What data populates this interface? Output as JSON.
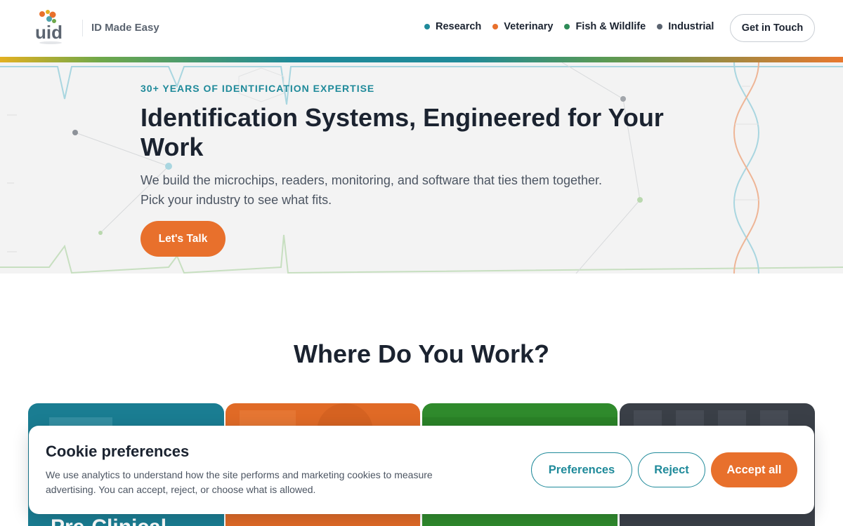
{
  "header": {
    "logo_text": "uid",
    "tagline": "ID Made Easy",
    "nav": [
      {
        "label": "Research",
        "dot_color": "#1f8a9a"
      },
      {
        "label": "Veterinary",
        "dot_color": "#e8702c"
      },
      {
        "label": "Fish & Wildlife",
        "dot_color": "#2e8b57"
      },
      {
        "label": "Industrial",
        "dot_color": "#5b6470"
      }
    ],
    "cta_label": "Get in Touch"
  },
  "hero": {
    "eyebrow": "30+ YEARS OF IDENTIFICATION EXPERTISE",
    "title": "Identification Systems, Engineered for Your Work",
    "description": "We build the microchips, readers, monitoring, and software that ties them together. Pick your industry to see what fits.",
    "button_label": "Let's Talk"
  },
  "section": {
    "title": "Where Do You Work?",
    "cards": [
      {
        "label": "Pre-Clinical",
        "color": "#1a7d92"
      },
      {
        "label": "",
        "color": "#e06a26"
      },
      {
        "label": "",
        "color": "#2f8a2c"
      },
      {
        "label": "",
        "color": "#3a3f47"
      }
    ]
  },
  "cookie": {
    "title": "Cookie preferences",
    "text": "We use analytics to understand how the site performs and marketing cookies to measure advertising. You can accept, reject, or choose what is allowed.",
    "preferences_label": "Preferences",
    "reject_label": "Reject",
    "accept_label": "Accept all"
  },
  "colors": {
    "accent_teal": "#1f8a9a",
    "accent_orange": "#e8702c"
  }
}
